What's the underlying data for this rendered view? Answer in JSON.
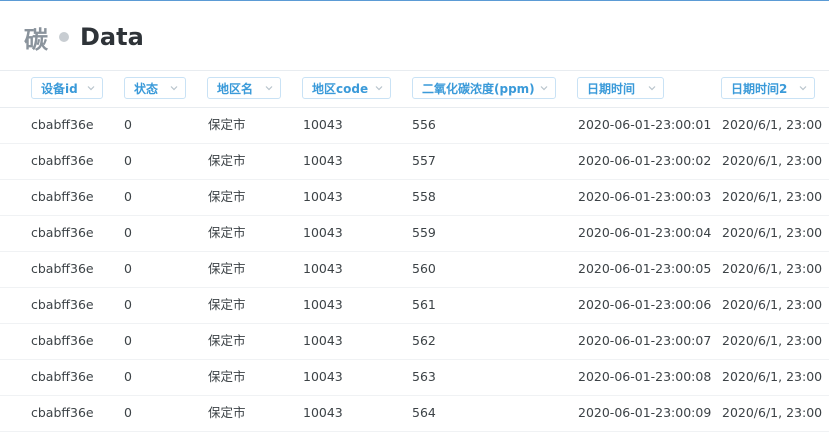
{
  "header": {
    "title_prefix": "碳",
    "title_main": "Data"
  },
  "columns": [
    {
      "key": "device_id",
      "label": "设备id"
    },
    {
      "key": "status",
      "label": "状态"
    },
    {
      "key": "region_name",
      "label": "地区名"
    },
    {
      "key": "region_code",
      "label": "地区code"
    },
    {
      "key": "co2",
      "label": "二氧化碳浓度(ppm)"
    },
    {
      "key": "datetime",
      "label": "日期时间"
    },
    {
      "key": "datetime2",
      "label": "日期时间2"
    }
  ],
  "rows": [
    {
      "device_id": "cbabff36e",
      "status": "0",
      "region_name": "保定市",
      "region_code": "10043",
      "co2": "556",
      "datetime": "2020-06-01-23:00:01",
      "datetime2": "2020/6/1, 23:00"
    },
    {
      "device_id": "cbabff36e",
      "status": "0",
      "region_name": "保定市",
      "region_code": "10043",
      "co2": "557",
      "datetime": "2020-06-01-23:00:02",
      "datetime2": "2020/6/1, 23:00"
    },
    {
      "device_id": "cbabff36e",
      "status": "0",
      "region_name": "保定市",
      "region_code": "10043",
      "co2": "558",
      "datetime": "2020-06-01-23:00:03",
      "datetime2": "2020/6/1, 23:00"
    },
    {
      "device_id": "cbabff36e",
      "status": "0",
      "region_name": "保定市",
      "region_code": "10043",
      "co2": "559",
      "datetime": "2020-06-01-23:00:04",
      "datetime2": "2020/6/1, 23:00"
    },
    {
      "device_id": "cbabff36e",
      "status": "0",
      "region_name": "保定市",
      "region_code": "10043",
      "co2": "560",
      "datetime": "2020-06-01-23:00:05",
      "datetime2": "2020/6/1, 23:00"
    },
    {
      "device_id": "cbabff36e",
      "status": "0",
      "region_name": "保定市",
      "region_code": "10043",
      "co2": "561",
      "datetime": "2020-06-01-23:00:06",
      "datetime2": "2020/6/1, 23:00"
    },
    {
      "device_id": "cbabff36e",
      "status": "0",
      "region_name": "保定市",
      "region_code": "10043",
      "co2": "562",
      "datetime": "2020-06-01-23:00:07",
      "datetime2": "2020/6/1, 23:00"
    },
    {
      "device_id": "cbabff36e",
      "status": "0",
      "region_name": "保定市",
      "region_code": "10043",
      "co2": "563",
      "datetime": "2020-06-01-23:00:08",
      "datetime2": "2020/6/1, 23:00"
    },
    {
      "device_id": "cbabff36e",
      "status": "0",
      "region_name": "保定市",
      "region_code": "10043",
      "co2": "564",
      "datetime": "2020-06-01-23:00:09",
      "datetime2": "2020/6/1, 23:00"
    }
  ]
}
